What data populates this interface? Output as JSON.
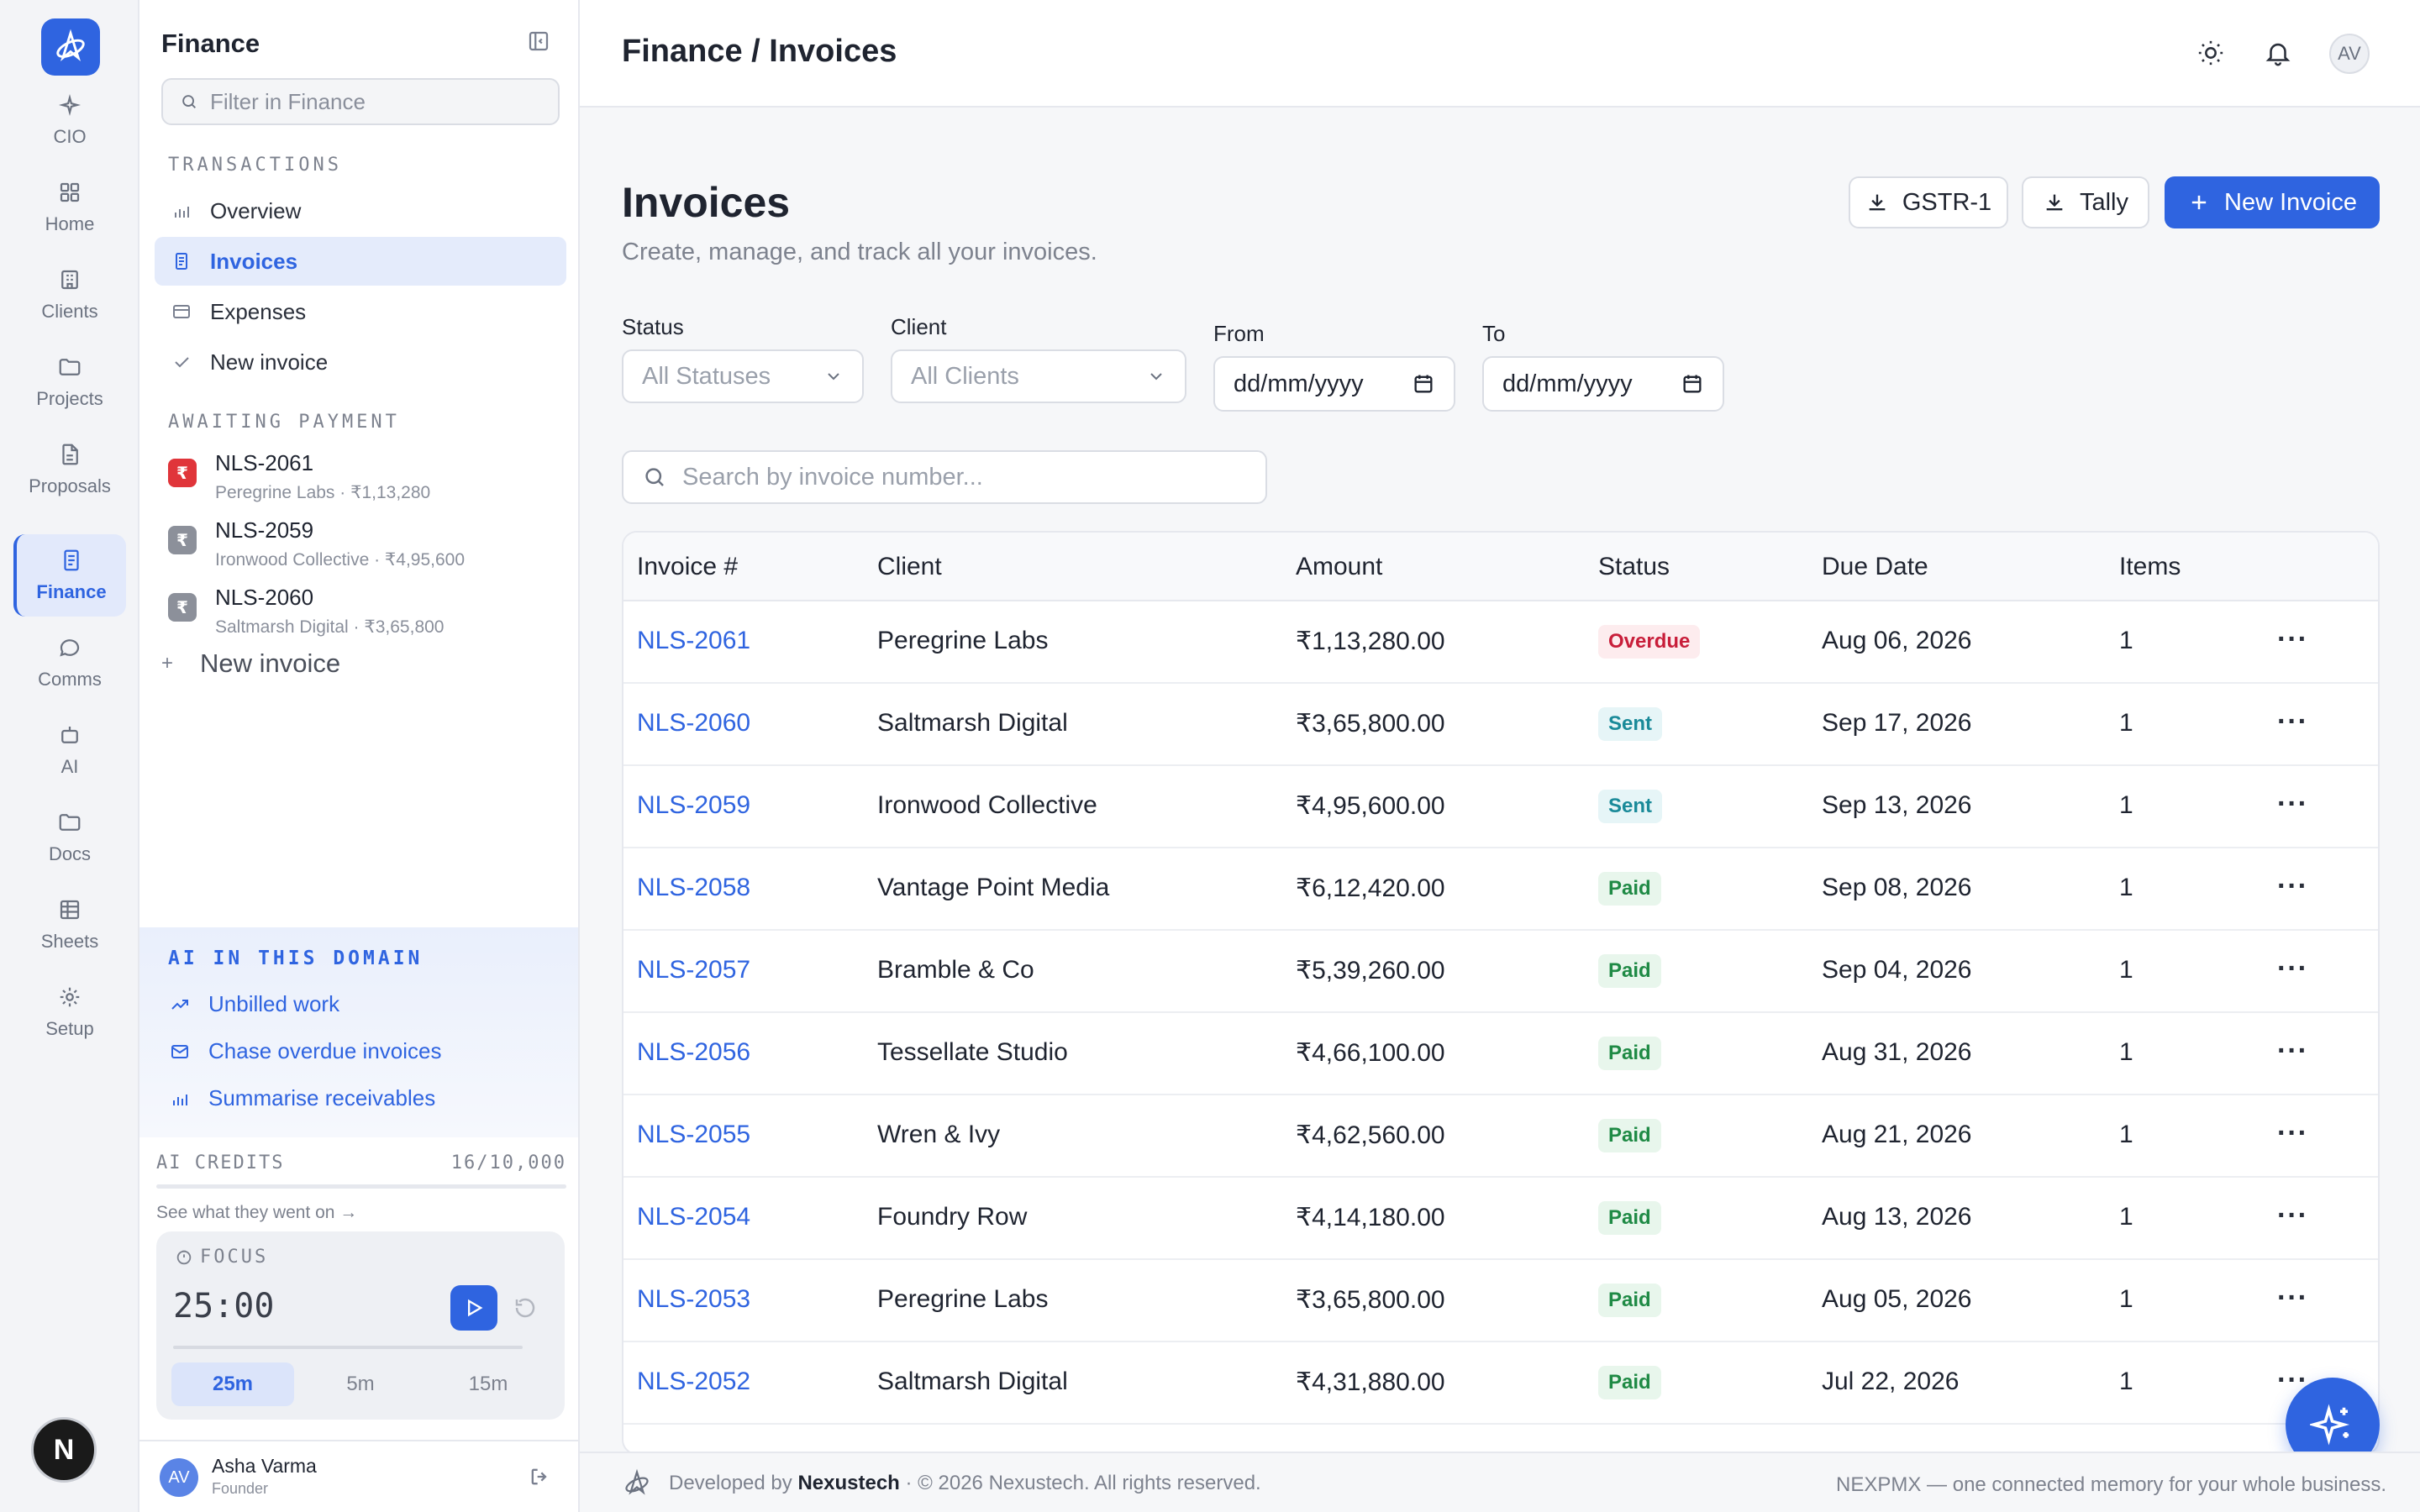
{
  "rail": {
    "items": [
      {
        "label": "CIO",
        "icon": "sparkle-icon"
      },
      {
        "label": "Home",
        "icon": "grid-icon"
      },
      {
        "label": "Clients",
        "icon": "building-icon"
      },
      {
        "label": "Projects",
        "icon": "folder-icon"
      },
      {
        "label": "Proposals",
        "icon": "document-icon"
      },
      {
        "label": "Finance",
        "icon": "receipt-icon"
      },
      {
        "label": "Comms",
        "icon": "chat-icon"
      },
      {
        "label": "AI",
        "icon": "robot-icon"
      },
      {
        "label": "Docs",
        "icon": "folder-icon"
      },
      {
        "label": "Sheets",
        "icon": "table-icon"
      },
      {
        "label": "Setup",
        "icon": "gear-icon"
      }
    ],
    "avatar_initial": "N"
  },
  "panel": {
    "title": "Finance",
    "search_placeholder": "Filter in Finance",
    "transactions_label": "TRANSACTIONS",
    "transactions": [
      {
        "label": "Overview"
      },
      {
        "label": "Invoices"
      },
      {
        "label": "Expenses"
      },
      {
        "label": "New invoice"
      }
    ],
    "awaiting_label": "AWAITING PAYMENT",
    "awaiting": [
      {
        "id": "NLS-2061",
        "sub": "Peregrine Labs · ₹1,13,280",
        "badge": "₹",
        "color": "#e0353a"
      },
      {
        "id": "NLS-2059",
        "sub": "Ironwood Collective · ₹4,95,600",
        "badge": "₹",
        "color": "#8c909a"
      },
      {
        "id": "NLS-2060",
        "sub": "Saltmarsh Digital · ₹3,65,800",
        "badge": "₹",
        "color": "#8c909a"
      }
    ],
    "new_invoice": "New invoice",
    "ai_label": "AI IN THIS DOMAIN",
    "ai_items": [
      {
        "label": "Unbilled work"
      },
      {
        "label": "Chase overdue invoices"
      },
      {
        "label": "Summarise receivables"
      }
    ],
    "credits_label": "AI CREDITS",
    "credits_value": "16/10,000",
    "credits_sub": "See what they went on →",
    "focus": {
      "label": "FOCUS",
      "time": "25:00",
      "options": [
        "25m",
        "5m",
        "15m"
      ]
    },
    "user": {
      "initials": "AV",
      "name": "Asha Varma",
      "role": "Founder"
    }
  },
  "topbar": {
    "breadcrumb": "Finance / Invoices",
    "avatar": "AV"
  },
  "page": {
    "title": "Invoices",
    "subtitle": "Create, manage, and track all your invoices.",
    "btn_gstr": "GSTR-1",
    "btn_tally": "Tally",
    "btn_new": "New Invoice",
    "filters": {
      "status_label": "Status",
      "status_value": "All Statuses",
      "client_label": "Client",
      "client_value": "All Clients",
      "from_label": "From",
      "from_value": "dd/mm/yyyy",
      "to_label": "To",
      "to_value": "dd/mm/yyyy"
    },
    "search_placeholder": "Search by invoice number..."
  },
  "table": {
    "headers": [
      "Invoice #",
      "Client",
      "Amount",
      "Status",
      "Due Date",
      "Items"
    ],
    "rows": [
      {
        "id": "NLS-2061",
        "client": "Peregrine Labs",
        "amount": "₹1,13,280.00",
        "status": "Overdue",
        "due": "Aug 06, 2026",
        "items": "1"
      },
      {
        "id": "NLS-2060",
        "client": "Saltmarsh Digital",
        "amount": "₹3,65,800.00",
        "status": "Sent",
        "due": "Sep 17, 2026",
        "items": "1"
      },
      {
        "id": "NLS-2059",
        "client": "Ironwood Collective",
        "amount": "₹4,95,600.00",
        "status": "Sent",
        "due": "Sep 13, 2026",
        "items": "1"
      },
      {
        "id": "NLS-2058",
        "client": "Vantage Point Media",
        "amount": "₹6,12,420.00",
        "status": "Paid",
        "due": "Sep 08, 2026",
        "items": "1"
      },
      {
        "id": "NLS-2057",
        "client": "Bramble & Co",
        "amount": "₹5,39,260.00",
        "status": "Paid",
        "due": "Sep 04, 2026",
        "items": "1"
      },
      {
        "id": "NLS-2056",
        "client": "Tessellate Studio",
        "amount": "₹4,66,100.00",
        "status": "Paid",
        "due": "Aug 31, 2026",
        "items": "1"
      },
      {
        "id": "NLS-2055",
        "client": "Wren & Ivy",
        "amount": "₹4,62,560.00",
        "status": "Paid",
        "due": "Aug 21, 2026",
        "items": "1"
      },
      {
        "id": "NLS-2054",
        "client": "Foundry Row",
        "amount": "₹4,14,180.00",
        "status": "Paid",
        "due": "Aug 13, 2026",
        "items": "1"
      },
      {
        "id": "NLS-2053",
        "client": "Peregrine Labs",
        "amount": "₹3,65,800.00",
        "status": "Paid",
        "due": "Aug 05, 2026",
        "items": "1"
      },
      {
        "id": "NLS-2052",
        "client": "Saltmarsh Digital",
        "amount": "₹4,31,880.00",
        "status": "Paid",
        "due": "Jul 22, 2026",
        "items": "1"
      }
    ]
  },
  "footer": {
    "prefix": "Developed by",
    "brand": "Nexustech",
    "suffix": "· © 2026 Nexustech. All rights reserved.",
    "right": "NEXPMX — one connected memory for your whole business."
  },
  "colors": {
    "accent": "#2f64e0",
    "overdue": "#c81e3a",
    "sent": "#1a8a99",
    "paid": "#1f8a45"
  }
}
